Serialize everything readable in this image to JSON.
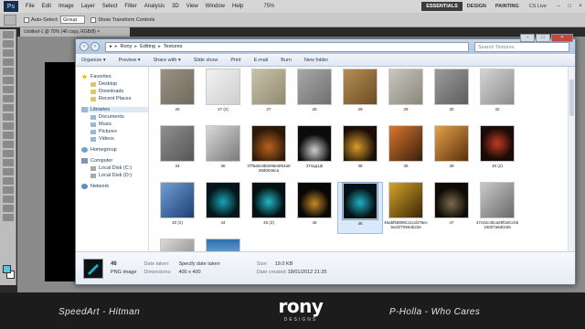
{
  "photoshop": {
    "menus": [
      "File",
      "Edit",
      "Image",
      "Layer",
      "Select",
      "Filter",
      "Analysis",
      "3D",
      "View",
      "Window",
      "Help"
    ],
    "zoom": "75%",
    "workspaces": [
      "ESSENTIALS",
      "DESIGN",
      "PAINTING"
    ],
    "cslive": "CS Live",
    "options": {
      "auto_select_label": "Auto-Select:",
      "auto_select_value": "Group",
      "transform_label": "Show Transform Controls"
    },
    "doc_tab": "Untitled-1 @ 70% (46 copy, RGB/8) ×"
  },
  "explorer": {
    "breadcrumb": [
      "Rony",
      "Editing",
      "Textures"
    ],
    "search_placeholder": "Search Textures",
    "toolbar": [
      "Organize ▾",
      "Preview ▾",
      "Share with ▾",
      "Slide show",
      "Print",
      "E-mail",
      "Burn",
      "New folder"
    ],
    "nav": {
      "favorites": "Favorites",
      "favorites_items": [
        "Desktop",
        "Downloads",
        "Recent Places"
      ],
      "libraries": "Libraries",
      "libraries_items": [
        "Documents",
        "Music",
        "Pictures",
        "Videos"
      ],
      "homegroup": "Homegroup",
      "computer": "Computer",
      "computer_items": [
        "Local Disk (C:)",
        "Local Disk (D:)"
      ],
      "network": "Network"
    },
    "files": [
      {
        "name": "26",
        "bg": "linear-gradient(135deg,#9a9282,#6f695e)"
      },
      {
        "name": "27 (2)",
        "bg": "linear-gradient(135deg,#f1f1f1,#cfcfcf)"
      },
      {
        "name": "27",
        "bg": "linear-gradient(135deg,#c9c3a8,#8f8a72)"
      },
      {
        "name": "28",
        "bg": "linear-gradient(135deg,#a8a8a8,#707070)"
      },
      {
        "name": "29",
        "bg": "linear-gradient(135deg,#b58e55,#6b4c22)"
      },
      {
        "name": "29",
        "bg": "linear-gradient(135deg,#c9c7bd,#8a887d)"
      },
      {
        "name": "30",
        "bg": "linear-gradient(135deg,#9b9b9b,#5e5e5e)"
      },
      {
        "name": "32",
        "bg": "linear-gradient(135deg,#d5d5d5,#8c8c8c)"
      },
      {
        "name": "34",
        "bg": "linear-gradient(135deg,#8f8f8f,#565656)"
      },
      {
        "name": "36",
        "bg": "linear-gradient(135deg,#d8d8d8,#7a7a7a)"
      },
      {
        "name": "37f5a0c9b0e96e6f64a639d0046ca",
        "bg": "radial-gradient(circle at 50% 60%,#b8621d,#2a1808 70%)"
      },
      {
        "name": "37sqq1j6",
        "bg": "radial-gradient(circle at 50% 70%,#cfcfcf,#0b0b0b 55%)"
      },
      {
        "name": "38",
        "bg": "radial-gradient(circle at 40% 60%,#d79b2b,#1a0e06 65%)"
      },
      {
        "name": "38",
        "bg": "linear-gradient(135deg,#d9782e,#3a1e0b)"
      },
      {
        "name": "39",
        "bg": "linear-gradient(135deg,#e6a24a,#5a2e0e)"
      },
      {
        "name": "40 (2)",
        "bg": "radial-gradient(circle at 50% 50%,#c23b22,#1a0a08 65%)"
      },
      {
        "name": "40 (2)",
        "bg": "linear-gradient(135deg,#6fa0d8,#1e3f6f)"
      },
      {
        "name": "44",
        "bg": "radial-gradient(circle at 50% 55%,#1aa3b8,#05161a 60%)"
      },
      {
        "name": "45 (2)",
        "bg": "radial-gradient(circle at 50% 55%,#23b6c8,#041214 60%)"
      },
      {
        "name": "45",
        "bg": "radial-gradient(circle at 50% 60%,#c98a2a,#0a0806 55%)"
      },
      {
        "name": "46",
        "bg": "radial-gradient(circle at 50% 55%,#1fb0c4,#061216 60%)",
        "selected": true
      },
      {
        "name": "46a5f58898c11cd478ec3ed1f70564b23e",
        "bg": "linear-gradient(135deg,#d6a42b,#3a2606)"
      },
      {
        "name": "47",
        "bg": "radial-gradient(circle at 50% 60%,#7a6a4a,#0e0b07 60%)"
      },
      {
        "name": "47c62c4bca29f2afccb516007a6d0c56",
        "bg": "linear-gradient(135deg,#c9c9c9,#6a6a6a)"
      },
      {
        "name": "49",
        "bg": "linear-gradient(135deg,#d9d9d9,#7d7d7d)"
      },
      {
        "name": "50-Awesome-HD-Wallpapers-1920x1200-20",
        "bg": "linear-gradient(#2b6fb0 0%,#7fb0d9 55%,#b9703a 56%,#5a3515 100%)"
      }
    ],
    "details": {
      "name": "46",
      "type": "PNG image",
      "date_taken_label": "Date taken:",
      "date_taken_value": "Specify date taken",
      "dimensions_label": "Dimensions:",
      "dimensions_value": "400 x 400",
      "size_label": "Size:",
      "size_value": "19.0 KB",
      "created_label": "Date created:",
      "created_value": "18/01/2012 21:35"
    }
  },
  "banner": {
    "left": "SpeedArt - Hitman",
    "logo": "rony",
    "logo_sub": "DESIGNS",
    "right": "P-Holla - Who Cares"
  }
}
